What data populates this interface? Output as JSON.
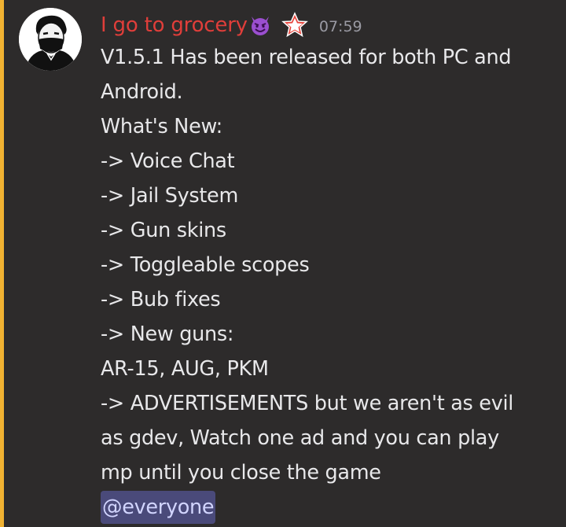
{
  "message": {
    "author": {
      "name": "I go to grocery",
      "name_color": "#e03e3a",
      "emoji": "smiling-imp-icon",
      "role_badge": "star-icon"
    },
    "timestamp": "07:59",
    "lines": [
      "V1.5.1 Has been released for both PC and",
      "Android.",
      "What's New:",
      "-> Voice Chat",
      "-> Jail System",
      "-> Gun skins",
      "-> Toggleable scopes",
      "-> Bub fixes",
      "-> New guns:",
      "AR-15, AUG, PKM",
      "-> ADVERTISEMENTS but we aren't as evil",
      "as gdev, Watch one ad and you can play",
      "mp until you close the game"
    ],
    "mention": "@everyone"
  },
  "colors": {
    "background": "#2d2b2b",
    "mention_bar": "#f0b232",
    "mention_bg": "#4a4a7a",
    "mention_text": "#d2d5ff"
  }
}
